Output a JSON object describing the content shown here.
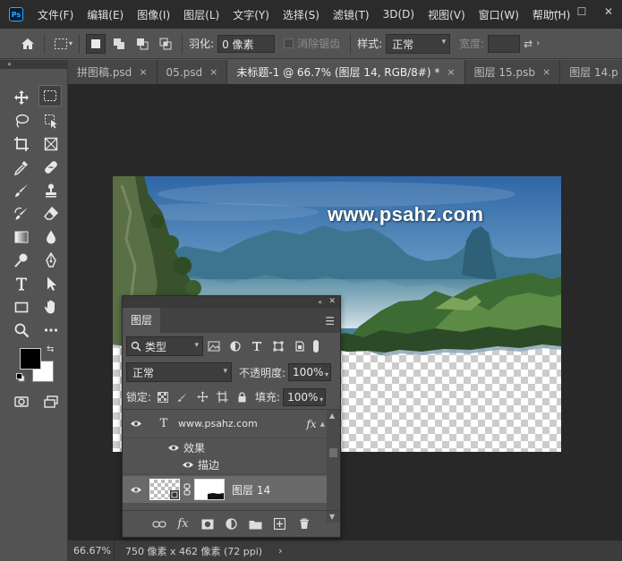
{
  "menubar": {
    "logo_text": "Ps",
    "items": [
      "文件(F)",
      "编辑(E)",
      "图像(I)",
      "图层(L)",
      "文字(Y)",
      "选择(S)",
      "滤镜(T)",
      "3D(D)",
      "视图(V)",
      "窗口(W)",
      "帮助(H)"
    ],
    "window_controls": [
      "—",
      "☐",
      "✕"
    ]
  },
  "options": {
    "feather_label": "羽化:",
    "feather_value": "0 像素",
    "antialias_label": "消除锯齿",
    "style_label": "样式:",
    "style_value": "正常",
    "width_label": "宽度:"
  },
  "tabs": [
    {
      "label": "拼图稿.psd",
      "close": "×"
    },
    {
      "label": "05.psd",
      "close": "×"
    },
    {
      "label": "未标题-1 @ 66.7% (图层 14, RGB/8#) *",
      "close": "×"
    },
    {
      "label": "图层 15.psb",
      "close": "×"
    },
    {
      "label": "图层 14.p",
      "close": ""
    }
  ],
  "canvas": {
    "watermark": "www.psahz.com"
  },
  "status": {
    "zoom": "66.67%",
    "doc_info": "750 像素 x 462 像素 (72 ppi)",
    "arrow": "›"
  },
  "layers_panel": {
    "title": "图层",
    "filter_kind": "类型",
    "blend_mode": "正常",
    "opacity_label": "不透明度:",
    "opacity_value": "100%",
    "lock_label": "锁定:",
    "fill_label": "填充:",
    "fill_value": "100%",
    "layers": [
      {
        "name": "www.psahz.com",
        "type_glyph": "T",
        "fx": "fx"
      },
      {
        "name": "效果"
      },
      {
        "name": "描边"
      },
      {
        "name": "图层 14"
      }
    ]
  },
  "colors": {
    "foreground": "#000000",
    "background": "#ffffff",
    "active_tab": "#535353",
    "workspace": "#282828"
  }
}
